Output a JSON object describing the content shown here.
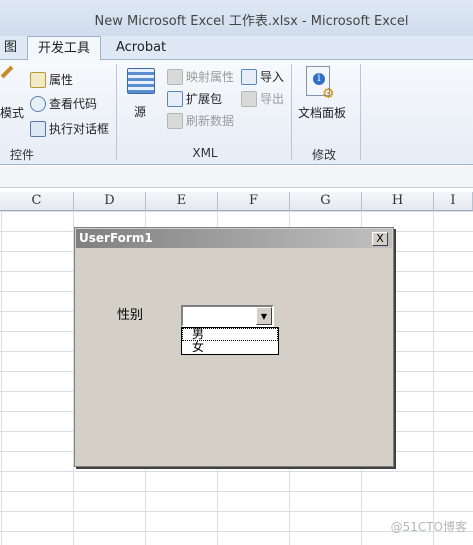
{
  "window": {
    "title": "New Microsoft Excel 工作表.xlsx  -  Microsoft Excel"
  },
  "tabs": [
    {
      "label": "图"
    },
    {
      "label": "开发工具"
    },
    {
      "label": "Acrobat"
    }
  ],
  "ribbon": {
    "controls": {
      "mode": "模式",
      "properties": "属性",
      "view_code": "查看代码",
      "run_dialog": "执行对话框",
      "label": "控件"
    },
    "xml": {
      "source": "源",
      "map_props": "映射属性",
      "import": "导入",
      "expansion_pack": "扩展包",
      "export": "导出",
      "refresh": "刷新数据",
      "label": "XML"
    },
    "modify": {
      "doc_panel": "文档面板",
      "label": "修改"
    }
  },
  "columns": [
    "C",
    "D",
    "E",
    "F",
    "G",
    "H",
    "I"
  ],
  "userform": {
    "caption": "UserForm1",
    "close": "X",
    "label": "性别",
    "combo_value": "",
    "options": [
      "男",
      "女"
    ]
  },
  "watermark": "@51CTO博客"
}
